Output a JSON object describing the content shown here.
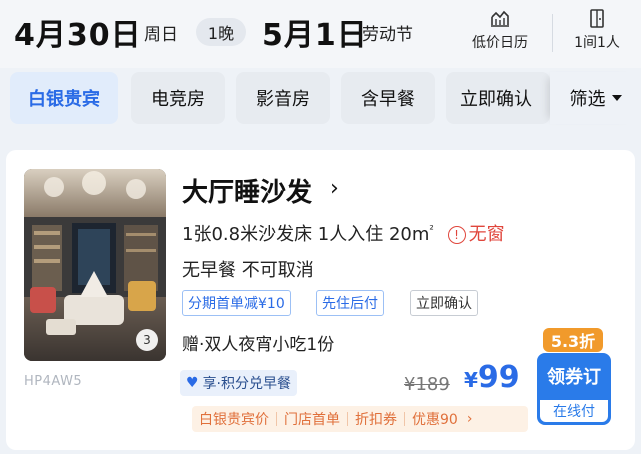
{
  "header": {
    "checkin_date": "4月30日",
    "checkin_weekday": "周日",
    "nights": "1晚",
    "checkout_date": "5月1日",
    "checkout_note": "劳动节",
    "calendar_label": "低价日历",
    "guests_label": "1间1人"
  },
  "filters": {
    "chips": [
      "白银贵宾",
      "电竞房",
      "影音房",
      "含早餐",
      "立即确认"
    ],
    "active_index": 0,
    "filter_label": "筛选"
  },
  "room": {
    "title": "大厅睡沙发",
    "specs": "1张0.8米沙发床  1人入住  20m",
    "area_unit_sup": "²",
    "warning": "无窗",
    "policy": "无早餐  不可取消",
    "tags": [
      "分期首单减¥10",
      "先住后付",
      "立即确认"
    ],
    "gift": "赠·双人夜宵小吃1份",
    "photo_count": "3",
    "code": "HP4AW5",
    "points_label": "享·积分兑早餐",
    "discount": "5.3折",
    "price_original": "¥189",
    "price_yen": "¥",
    "price_current": "99",
    "book_label": "领券订",
    "book_sub": "在线付",
    "promos": [
      "白银贵宾价",
      "门店首单",
      "折扣券",
      "优惠90"
    ]
  },
  "colors": {
    "accent_blue": "#2a6be6",
    "warning_red": "#e0463c",
    "discount_orange": "#f19a2b"
  }
}
